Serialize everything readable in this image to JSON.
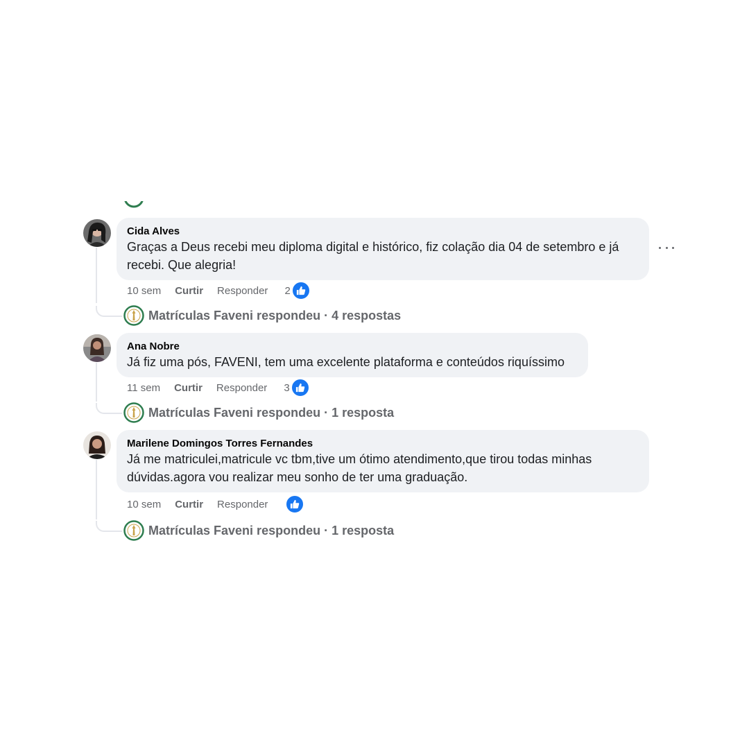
{
  "comments": [
    {
      "author": "Cida Alves",
      "text": "Graças a Deus recebi meu diploma digital e histórico, fiz colação dia 04 de setembro e já recebi. Que alegria!",
      "time": "10 sem",
      "like_label": "Curtir",
      "reply_label": "Responder",
      "reaction_count": "2",
      "reaction_icon": "thumbs-up-icon",
      "replies_summary": "Matrículas Faveni respondeu · 4 respostas"
    },
    {
      "author": "Ana Nobre",
      "text": "Já fiz uma pós, FAVENI, tem uma excelente plataforma e conteúdos riquíssimo",
      "time": "11 sem",
      "like_label": "Curtir",
      "reply_label": "Responder",
      "reaction_count": "3",
      "reaction_icon": "thumbs-up-icon",
      "replies_summary": "Matrículas Faveni respondeu · 1 resposta"
    },
    {
      "author": "Marilene Domingos Torres Fernandes",
      "text": "Já me matriculei,matricule vc tbm,tive um ótimo atendimento,que tirou todas minhas dúvidas.agora vou realizar meu sonho de ter uma graduação.",
      "time": "10 sem",
      "like_label": "Curtir",
      "reply_label": "Responder",
      "reaction_count": "",
      "reaction_icon": "thumbs-up-icon",
      "replies_summary": "Matrículas Faveni respondeu · 1 resposta"
    }
  ],
  "colors": {
    "bubble": "#f0f2f5",
    "secondary_text": "#65676b",
    "like_blue": "#1877f2",
    "thread_line": "#e4e6eb",
    "page_logo_green": "#2e7d4f"
  }
}
